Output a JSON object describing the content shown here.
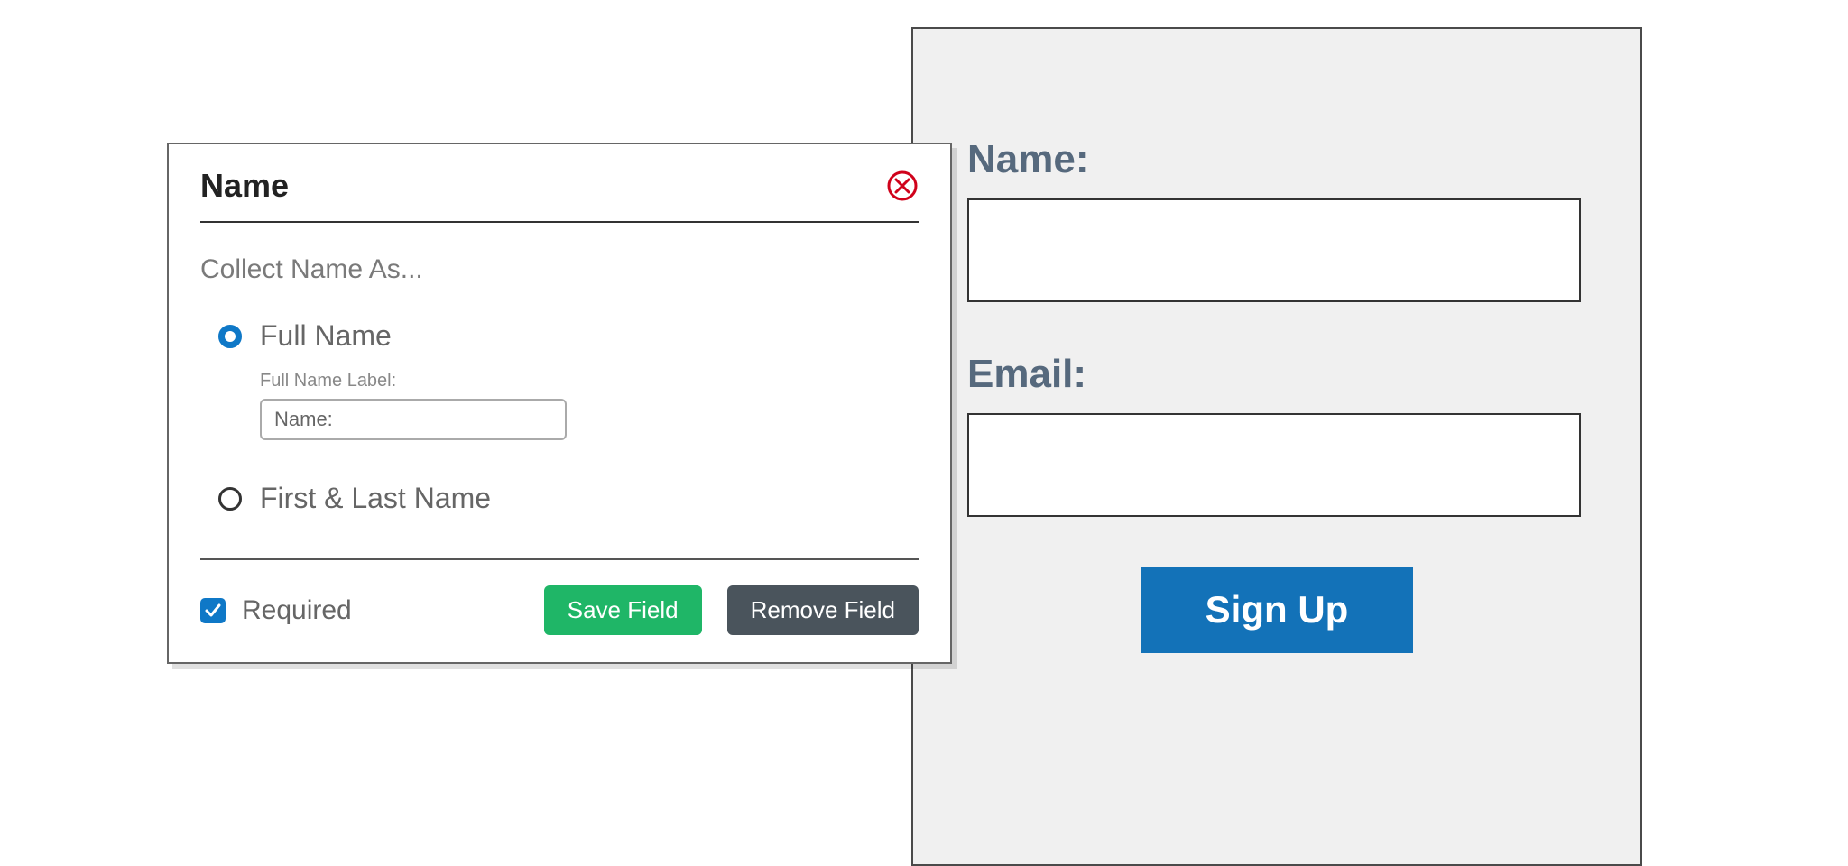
{
  "modal": {
    "title": "Name",
    "sectionLabel": "Collect Name As...",
    "options": {
      "fullName": {
        "label": "Full Name",
        "sublabel": "Full Name Label:",
        "inputValue": "Name:",
        "selected": true
      },
      "firstLast": {
        "label": "First & Last Name",
        "selected": false
      }
    },
    "requiredLabel": "Required",
    "requiredChecked": true,
    "saveLabel": "Save Field",
    "removeLabel": "Remove Field"
  },
  "preview": {
    "fields": [
      {
        "label": "Name:"
      },
      {
        "label": "Email:"
      }
    ],
    "submitLabel": "Sign Up"
  },
  "colors": {
    "accent": "#0f78c7",
    "success": "#1fb667",
    "dark": "#4a545c",
    "close": "#d0021b"
  }
}
